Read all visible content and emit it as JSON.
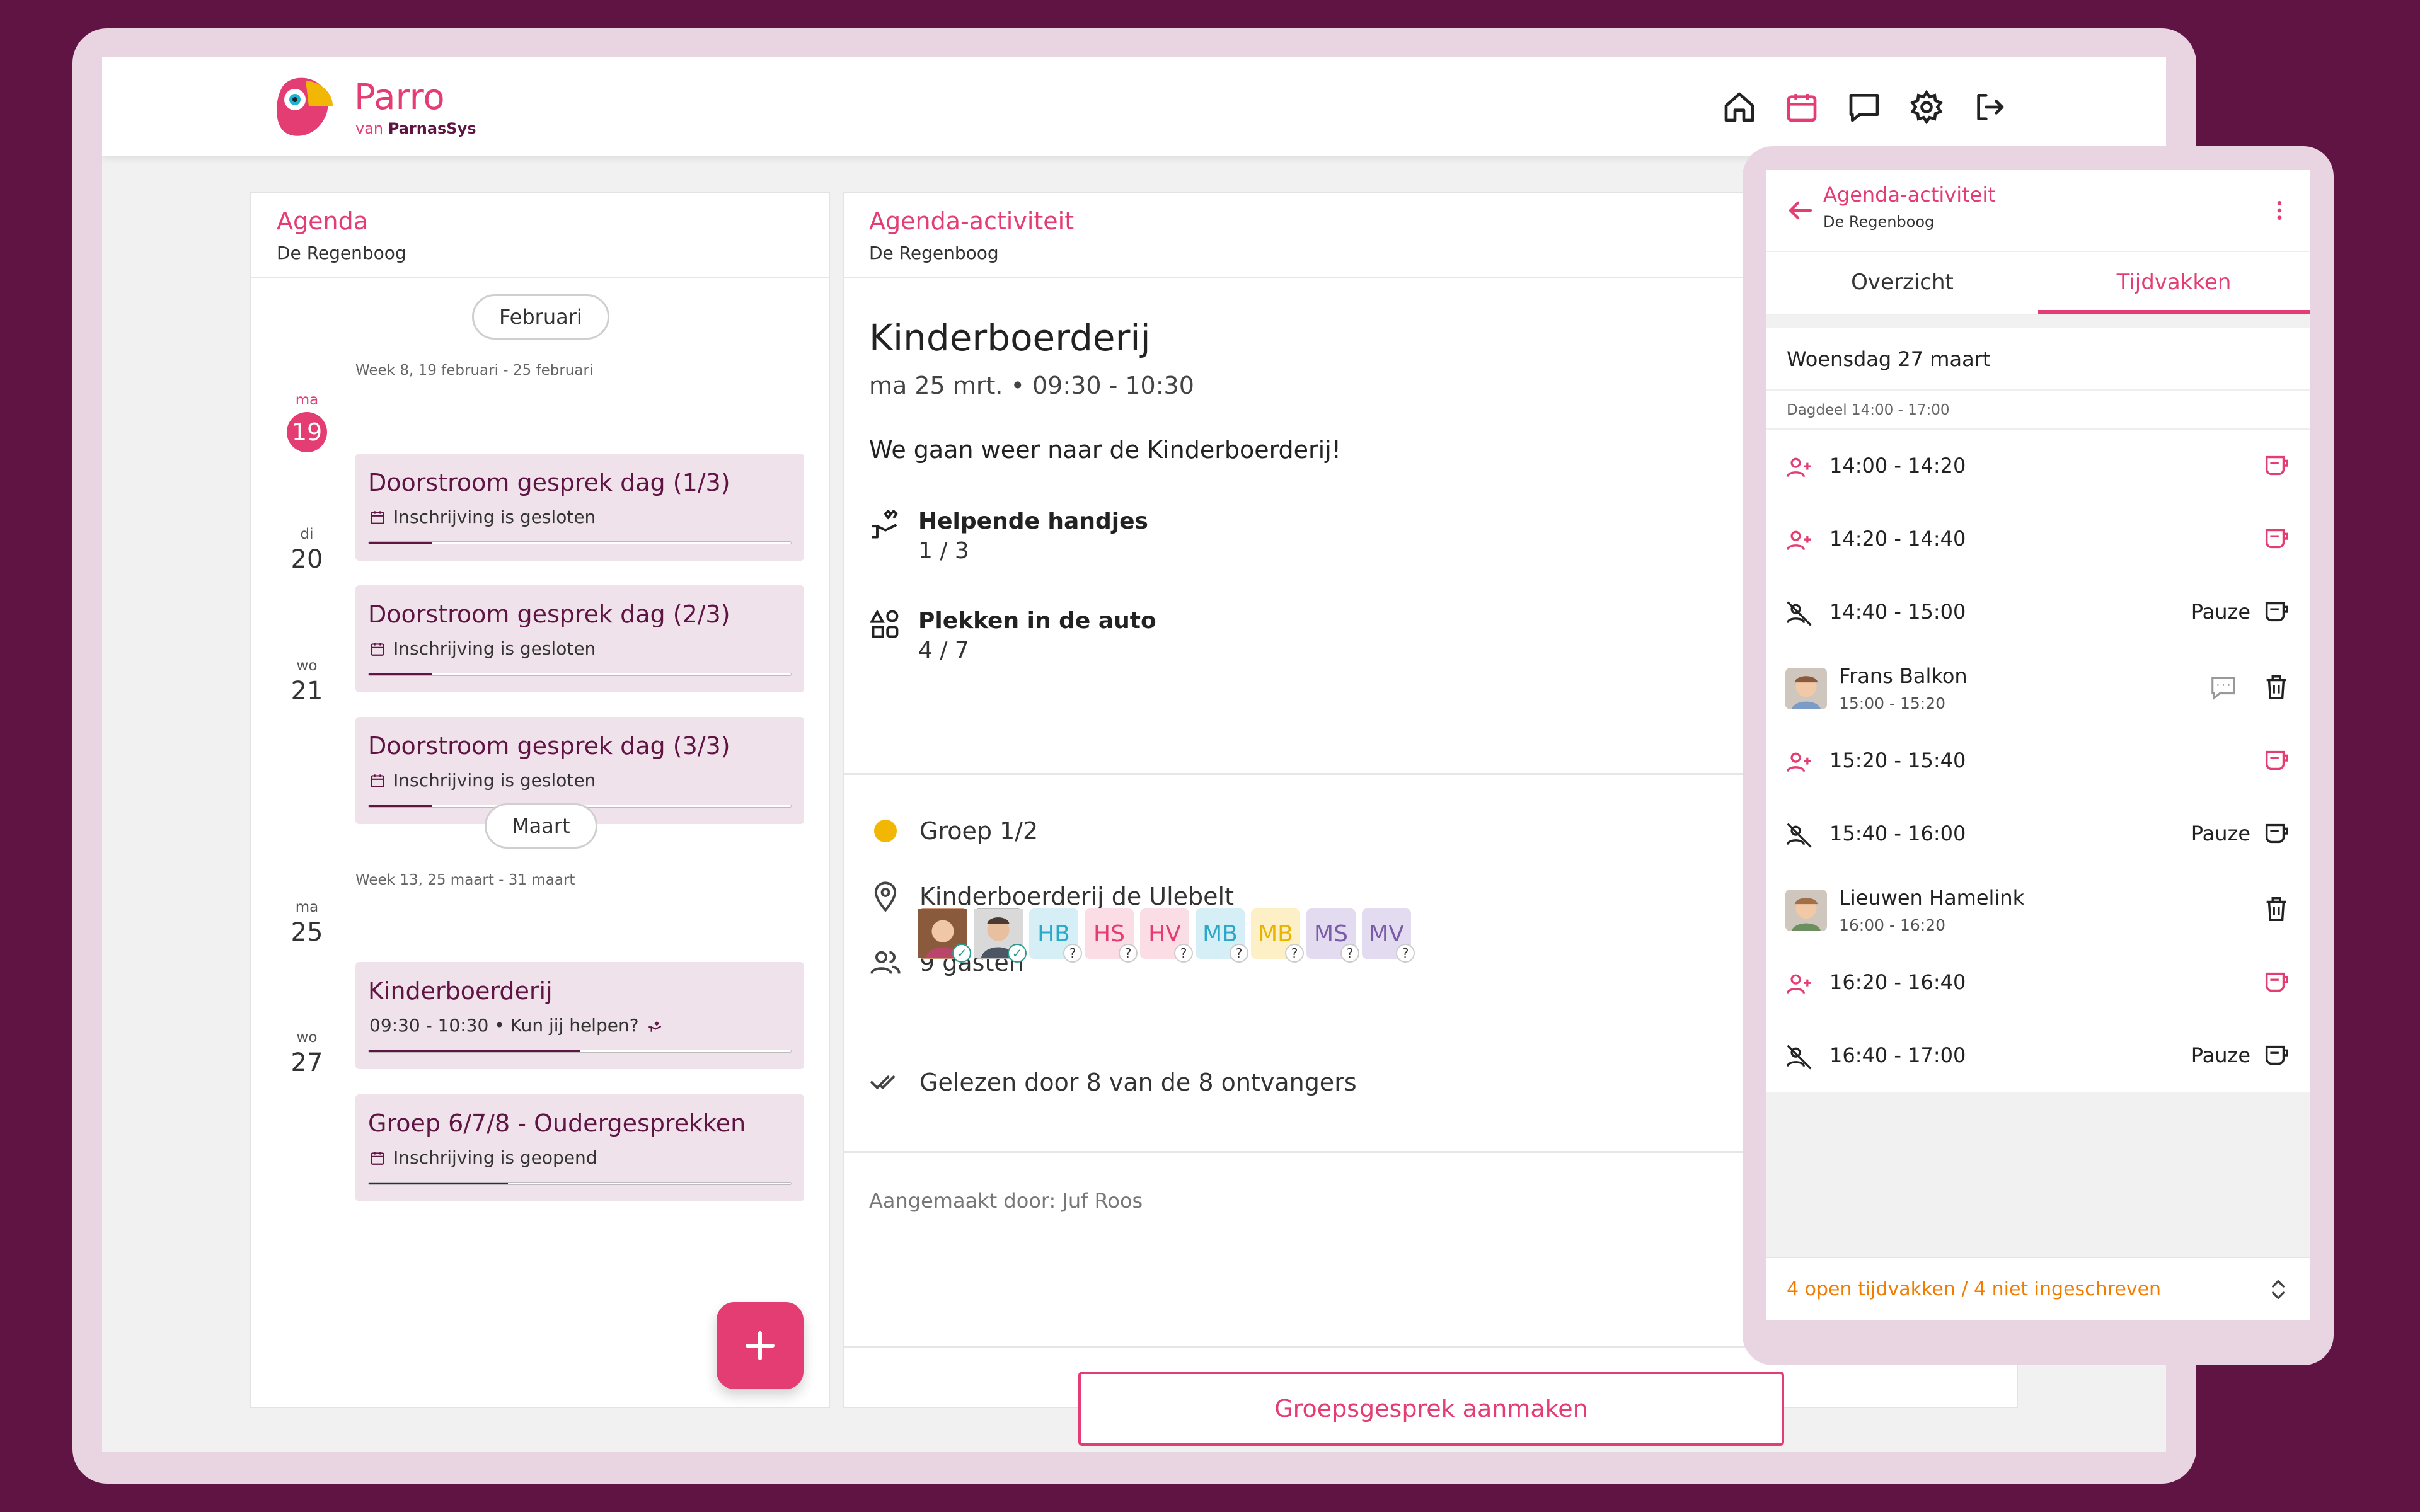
{
  "colors": {
    "brand": "#e43d73",
    "plum": "#5f1444",
    "orange": "#f07d00"
  },
  "brand": {
    "name": "Parro",
    "sub_prefix": "van",
    "sub_brand": "ParnasSys"
  },
  "nav": [
    {
      "icon": "home-icon"
    },
    {
      "icon": "calendar-icon"
    },
    {
      "icon": "chat-icon"
    },
    {
      "icon": "gear-icon"
    },
    {
      "icon": "logout-icon"
    }
  ],
  "agenda": {
    "title": "Agenda",
    "subtitle": "De Regenboog",
    "months": [
      {
        "label": "Februari",
        "week": "Week 8, 19 februari - 25 februari",
        "days": [
          {
            "abbr": "ma",
            "num": "19",
            "today": true,
            "event": {
              "title": "Doorstroom gesprek dag (1/3)",
              "sub": "Inschrijving is gesloten",
              "progress": 0.15
            }
          },
          {
            "abbr": "di",
            "num": "20",
            "event": {
              "title": "Doorstroom gesprek dag (2/3)",
              "sub": "Inschrijving is gesloten",
              "progress": 0.15
            }
          },
          {
            "abbr": "wo",
            "num": "21",
            "event": {
              "title": "Doorstroom gesprek dag (3/3)",
              "sub": "Inschrijving is gesloten",
              "progress": 0.15
            }
          }
        ]
      },
      {
        "label": "Maart",
        "week": "Week 13, 25 maart - 31 maart",
        "days": [
          {
            "abbr": "ma",
            "num": "25",
            "event": {
              "title": "Kinderboerderij",
              "sub": "09:30 - 10:30 • Kun jij helpen?",
              "progress": 0.5
            }
          },
          {
            "abbr": "wo",
            "num": "27",
            "event": {
              "title": "Groep 6/7/8 - Oudergesprekken",
              "sub": "Inschrijving is geopend",
              "progress": 0.33
            }
          }
        ]
      }
    ]
  },
  "detail": {
    "header_title": "Agenda-activiteit",
    "header_sub": "De Regenboog",
    "title": "Kinderboerderij",
    "when": "ma 25 mrt. • 09:30 - 10:30",
    "description": "We gaan weer naar de Kinderboerderij!",
    "help": {
      "label": "Helpende handjes",
      "value": "1 / 3"
    },
    "car": {
      "label": "Plekken in de auto",
      "value": "4 / 7"
    },
    "group": "Groep 1/2",
    "location": "Kinderboerderij de Ulebelt",
    "guests_label": "9 gasten",
    "guests": [
      {
        "initials": "",
        "photo": true,
        "status": "ok"
      },
      {
        "initials": "",
        "photo": true,
        "status": "ok"
      },
      {
        "initials": "HB",
        "bg": "#d6eef6",
        "fg": "#2aa8c8",
        "status": "?"
      },
      {
        "initials": "HS",
        "bg": "#fbdde6",
        "fg": "#e43d73",
        "status": "?"
      },
      {
        "initials": "HV",
        "bg": "#fbdde6",
        "fg": "#e43d73",
        "status": "?"
      },
      {
        "initials": "MB",
        "bg": "#d6eef6",
        "fg": "#2aa8c8",
        "status": "?"
      },
      {
        "initials": "MB",
        "bg": "#fdf0c7",
        "fg": "#e8b400",
        "status": "?"
      },
      {
        "initials": "MS",
        "bg": "#e3dbef",
        "fg": "#7a5ba8",
        "status": "?"
      },
      {
        "initials": "MV",
        "bg": "#e3dbef",
        "fg": "#7a5ba8",
        "status": "?"
      }
    ],
    "read_by": "Gelezen door 8 van de 8 ontvangers",
    "created_by": "Aangemaakt door: Juf Roos",
    "create_button": "Groepsgesprek aanmaken"
  },
  "mobile": {
    "title": "Agenda-activiteit",
    "sub": "De Regenboog",
    "tabs": [
      "Overzicht",
      "Tijdvakken"
    ],
    "active_tab": 1,
    "date": "Woensdag 27 maart",
    "daypart": "Dagdeel 14:00 - 17:00",
    "slots": [
      {
        "kind": "open",
        "time": "14:00 - 14:20"
      },
      {
        "kind": "open",
        "time": "14:20 - 14:40"
      },
      {
        "kind": "pause",
        "time": "14:40 - 15:00",
        "label": "Pauze"
      },
      {
        "kind": "booked",
        "name": "Frans Balkon",
        "time": "15:00 - 15:20",
        "chat": true
      },
      {
        "kind": "open",
        "time": "15:20 - 15:40"
      },
      {
        "kind": "pause",
        "time": "15:40 - 16:00",
        "label": "Pauze"
      },
      {
        "kind": "booked",
        "name": "Lieuwen Hamelink",
        "time": "16:00 - 16:20",
        "chat": false
      },
      {
        "kind": "open",
        "time": "16:20 - 16:40"
      },
      {
        "kind": "pause",
        "time": "16:40 - 17:00",
        "label": "Pauze"
      }
    ],
    "footer": "4 open tijdvakken / 4 niet ingeschreven"
  }
}
